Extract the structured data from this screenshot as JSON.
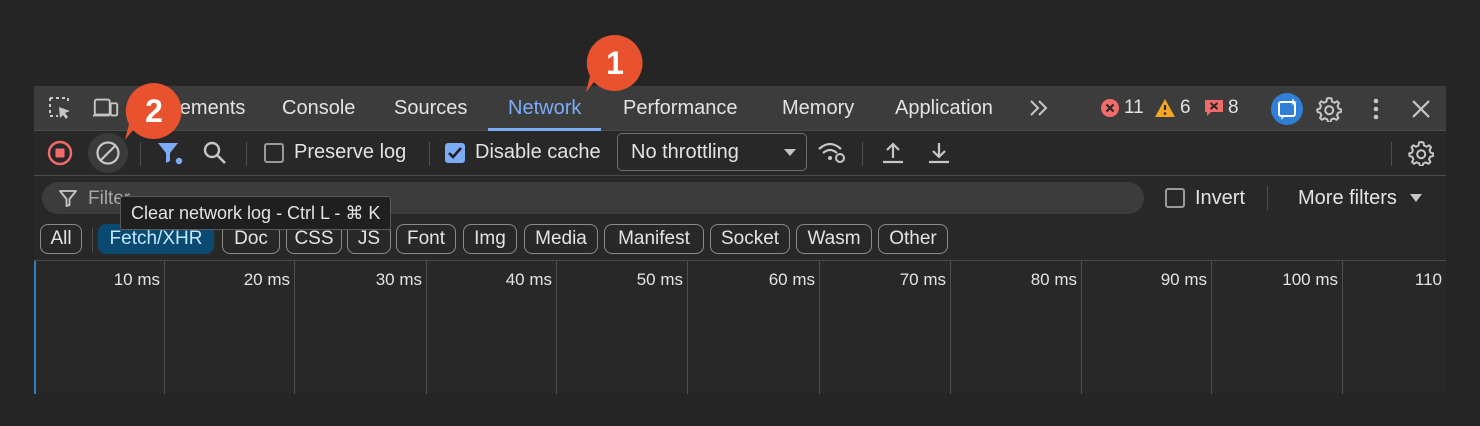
{
  "tabs": [
    {
      "label": "Elements",
      "active": false
    },
    {
      "label": "Console",
      "active": false
    },
    {
      "label": "Sources",
      "active": false
    },
    {
      "label": "Network",
      "active": true
    },
    {
      "label": "Performance",
      "active": false
    },
    {
      "label": "Memory",
      "active": false
    },
    {
      "label": "Application",
      "active": false
    }
  ],
  "tab_overflow": "»",
  "counters": {
    "errors": "11",
    "warnings": "6",
    "messages": "8"
  },
  "toolbar": {
    "preserve_log": {
      "label": "Preserve log",
      "checked": false
    },
    "disable_cache": {
      "label": "Disable cache",
      "checked": true
    },
    "throttling": "No throttling"
  },
  "filter": {
    "placeholder": "Filter",
    "tooltip": "Clear network log - Ctrl L - ⌘ K",
    "invert_label": "Invert",
    "invert_checked": false,
    "more_filters_label": "More filters"
  },
  "type_filters": [
    {
      "label": "All",
      "selected": false
    },
    {
      "label": "Fetch/XHR",
      "selected": true
    },
    {
      "label": "Doc",
      "selected": false
    },
    {
      "label": "CSS",
      "selected": false
    },
    {
      "label": "JS",
      "selected": false
    },
    {
      "label": "Font",
      "selected": false
    },
    {
      "label": "Img",
      "selected": false
    },
    {
      "label": "Media",
      "selected": false
    },
    {
      "label": "Manifest",
      "selected": false
    },
    {
      "label": "Socket",
      "selected": false
    },
    {
      "label": "Wasm",
      "selected": false
    },
    {
      "label": "Other",
      "selected": false
    }
  ],
  "timeline_ticks": [
    "10 ms",
    "20 ms",
    "30 ms",
    "40 ms",
    "50 ms",
    "60 ms",
    "70 ms",
    "80 ms",
    "90 ms",
    "100 ms",
    "110"
  ],
  "annotations": [
    {
      "number": "1",
      "target": "Network tab"
    },
    {
      "number": "2",
      "target": "Clear network log button"
    }
  ],
  "colors": {
    "accent": "#7cacf8",
    "annotation": "#e8522f",
    "error": "#f26b6b",
    "warning": "#f5a623"
  }
}
